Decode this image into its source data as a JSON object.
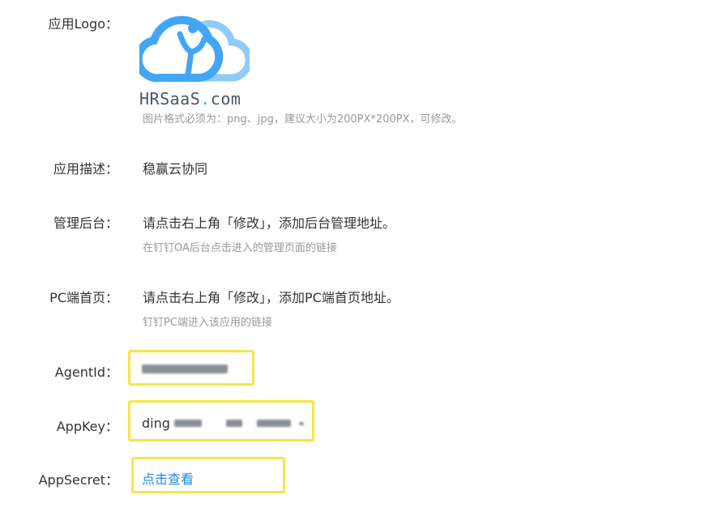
{
  "logo_row": {
    "label": "应用Logo：",
    "logo_text_main": "HRSaaS",
    "logo_text_dot": ".",
    "logo_text_suffix": "com",
    "hint": "图片格式必须为：png、jpg，建议大小为200PX*200PX，可修改。"
  },
  "description_row": {
    "label": "应用描述：",
    "value": "稳赢云协同"
  },
  "admin_row": {
    "label": "管理后台：",
    "value": "请点击右上角「修改」，添加后台管理地址。",
    "hint": "在钉钉OA后台点击进入的管理页面的链接"
  },
  "pc_home_row": {
    "label": "PC端首页：",
    "value": "请点击右上角「修改」，添加PC端首页地址。",
    "hint": "钉钉PC端进入该应用的链接"
  },
  "agentid_row": {
    "label": "AgentId："
  },
  "appkey_row": {
    "label": "AppKey：",
    "value_prefix": "ding"
  },
  "appsecret_row": {
    "label": "AppSecret：",
    "link": "点击查看"
  },
  "colors": {
    "highlight": "#f7e548",
    "link": "#1e88e5",
    "logo_blue": "#42a5f5",
    "logo_light_blue": "#90caf9"
  }
}
